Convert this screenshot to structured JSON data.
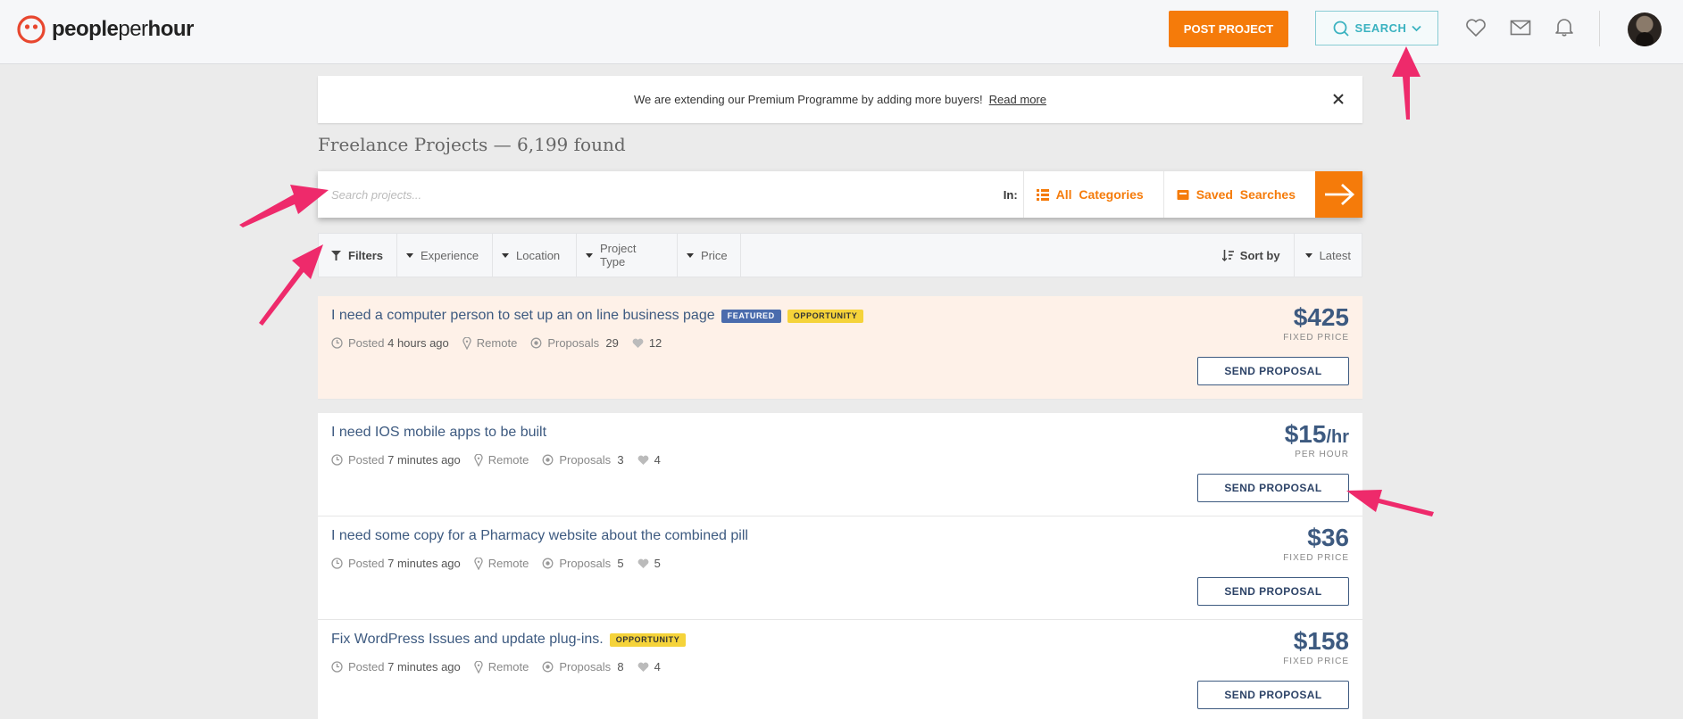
{
  "header": {
    "logo_bold": "people",
    "logo_thin": "per",
    "logo_end": "hour",
    "post_label": "POST PROJECT",
    "search_label": "SEARCH"
  },
  "notice": {
    "text": "We are extending our Premium Programme by adding more buyers!",
    "link": "Read more"
  },
  "page_title": "Freelance Projects — 6,199 found",
  "search": {
    "placeholder": "Search projects...",
    "in_label": "In:",
    "categories_label": "All  Categories",
    "saved_label": "Saved  Searches"
  },
  "filters": {
    "filters_label": "Filters",
    "experience": "Experience",
    "location": "Location",
    "project_type": "Project Type",
    "price": "Price",
    "sort_label": "Sort by",
    "sort_value": "Latest"
  },
  "projects": [
    {
      "title": "I need a computer person to set up an on line business page",
      "tag_featured": "FEATURED",
      "tag_opportunity": "OPPORTUNITY",
      "posted_label": "Posted",
      "posted": "4 hours ago",
      "location": "Remote",
      "proposals_label": "Proposals",
      "proposals": "29",
      "likes": "12",
      "price": "$425",
      "price_unit": "",
      "price_type": "FIXED PRICE",
      "cta": "SEND PROPOSAL"
    },
    {
      "title": "I need IOS mobile apps to be built",
      "posted_label": "Posted",
      "posted": "7 minutes ago",
      "location": "Remote",
      "proposals_label": "Proposals",
      "proposals": "3",
      "likes": "4",
      "price": "$15",
      "price_unit": "/hr",
      "price_type": "PER HOUR",
      "cta": "SEND PROPOSAL"
    },
    {
      "title": "I need some copy for a Pharmacy website about the combined pill",
      "posted_label": "Posted",
      "posted": "7 minutes ago",
      "location": "Remote",
      "proposals_label": "Proposals",
      "proposals": "5",
      "likes": "5",
      "price": "$36",
      "price_unit": "",
      "price_type": "FIXED PRICE",
      "cta": "SEND PROPOSAL"
    },
    {
      "title": "Fix WordPress Issues and update plug-ins.",
      "tag_opportunity": "OPPORTUNITY",
      "posted_label": "Posted",
      "posted": "7 minutes ago",
      "location": "Remote",
      "proposals_label": "Proposals",
      "proposals": "8",
      "likes": "4",
      "price": "$158",
      "price_unit": "",
      "price_type": "FIXED PRICE",
      "cta": "SEND PROPOSAL"
    }
  ],
  "colors": {
    "brand_orange": "#f57b0a",
    "search_teal": "#3ab2c0",
    "title_blue": "#3d5a80",
    "featured_bg": "#fef1e8",
    "annotation_pink": "#ee2a6b"
  },
  "icons": [
    "logo-icon",
    "search-icon",
    "chevron-down-icon",
    "heart-icon",
    "mail-icon",
    "bell-icon",
    "close-icon",
    "list-icon",
    "folder-icon",
    "arrow-right-icon",
    "filter-icon",
    "sort-icon",
    "clock-icon",
    "location-pin-icon",
    "target-icon"
  ]
}
